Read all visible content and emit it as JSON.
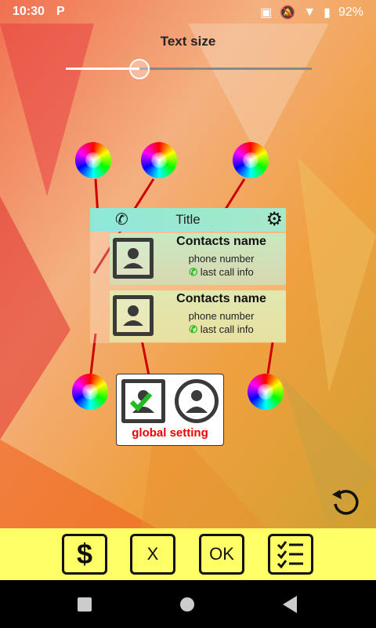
{
  "status_bar": {
    "time": "10:30",
    "app_badge": "P",
    "battery": "92%"
  },
  "settings": {
    "text_size_label": "Text size",
    "text_size_level": 0.3
  },
  "widget_preview": {
    "title": "Title",
    "contacts": [
      {
        "name": "Contacts name",
        "phone": "phone number",
        "call_info": "last call info"
      },
      {
        "name": "Contacts name",
        "phone": "phone number",
        "call_info": "last call info"
      }
    ]
  },
  "global_setting": {
    "label": "global setting"
  },
  "toolbar": {
    "buttons": [
      {
        "label": "$"
      },
      {
        "label": "X"
      },
      {
        "label": "OK"
      },
      {
        "label": "checklist-icon"
      }
    ]
  },
  "colors": {
    "accent_red": "#e00000",
    "bar_yellow": "#ffff66",
    "header_teal": "#8ee8d8"
  }
}
